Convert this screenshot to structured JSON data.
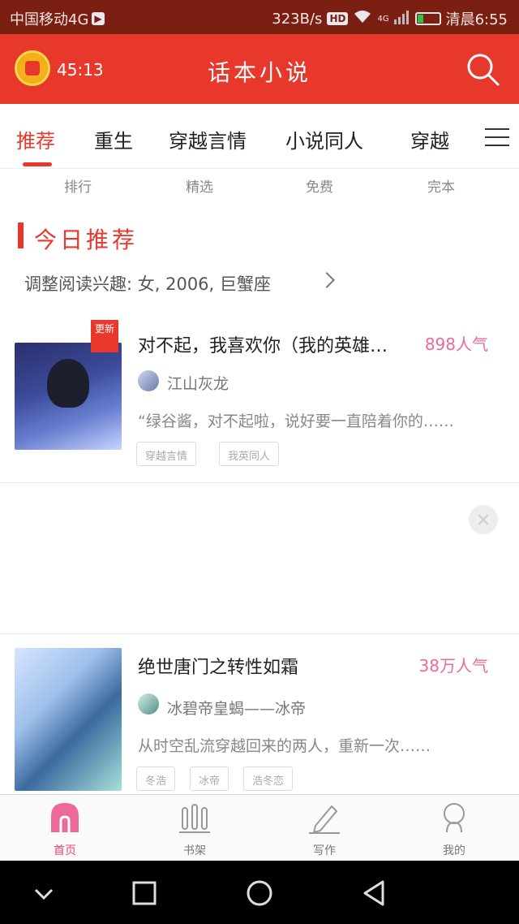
{
  "status_bar": {
    "carrier": "中国移动4G",
    "speed": "323B/s",
    "hd": "HD",
    "network": "4G",
    "battery_level": 0.25,
    "time": "清晨6:55"
  },
  "app_bar": {
    "timer": "45:13",
    "title": "话本小说"
  },
  "tabs": [
    {
      "label": "推荐",
      "active": true
    },
    {
      "label": "重生"
    },
    {
      "label": "穿越言情"
    },
    {
      "label": "小说同人"
    },
    {
      "label": "穿越"
    }
  ],
  "sub_tabs": [
    "排行",
    "精选",
    "免费",
    "完本"
  ],
  "today": {
    "title": "今日推荐",
    "interest": "调整阅读兴趣: 女, 2006, 巨蟹座"
  },
  "books": [
    {
      "badge": "更新",
      "title": "对不起，我喜欢你（我的英雄学院）",
      "popularity": "898人气",
      "author": "江山灰龙",
      "summary": "“绿谷酱，对不起啦，说好要一直陪着你的……",
      "tags": [
        "穿越言情",
        "我英同人"
      ]
    },
    {
      "title": "绝世唐门之转性如霜",
      "popularity": "38万人气",
      "author": "冰碧帝皇蝎——冰帝",
      "summary": "从时空乱流穿越回来的两人，重新一次……",
      "tags": [
        "冬浩",
        "冰帝",
        "浩冬恋"
      ]
    }
  ],
  "bottom_nav": [
    {
      "label": "首页",
      "icon": "home-icon",
      "active": true
    },
    {
      "label": "书架",
      "icon": "bookshelf-icon"
    },
    {
      "label": "写作",
      "icon": "pencil-icon"
    },
    {
      "label": "我的",
      "icon": "profile-icon"
    }
  ],
  "colors": {
    "status_bar": "#7a1f12",
    "accent": "#e8382b",
    "popularity": "#ec6a9a",
    "nav_active": "#e8487a"
  }
}
